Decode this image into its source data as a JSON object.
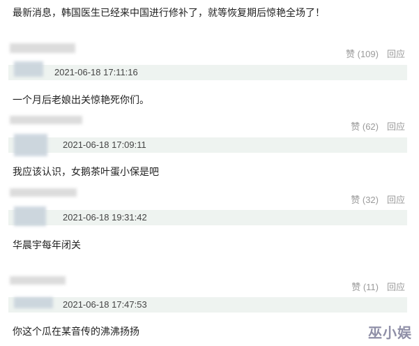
{
  "top_message": "最新消息，韩国医生已经来中国进行修补了，就等恢复期后惊艳全场了！",
  "comments": [
    {
      "likes": "赞 (109)",
      "reply": "回应",
      "timestamp": "2021-06-18 17:11:16",
      "text": "一个月后老娘出关惊艳死你们。"
    },
    {
      "likes": "赞 (62)",
      "reply": "回应",
      "timestamp": "2021-06-18 17:09:11",
      "text": "我应该认识，女鹅茶叶蛋小保是吧"
    },
    {
      "likes": "赞 (32)",
      "reply": "回应",
      "timestamp": "2021-06-18 19:31:42",
      "text": "华晨宇每年闭关"
    },
    {
      "likes": "赞 (11)",
      "reply": "回应",
      "timestamp": "2021-06-18 17:47:53",
      "text": "你这个瓜在某音传的沸沸扬扬"
    }
  ],
  "watermark": "巫小娱"
}
